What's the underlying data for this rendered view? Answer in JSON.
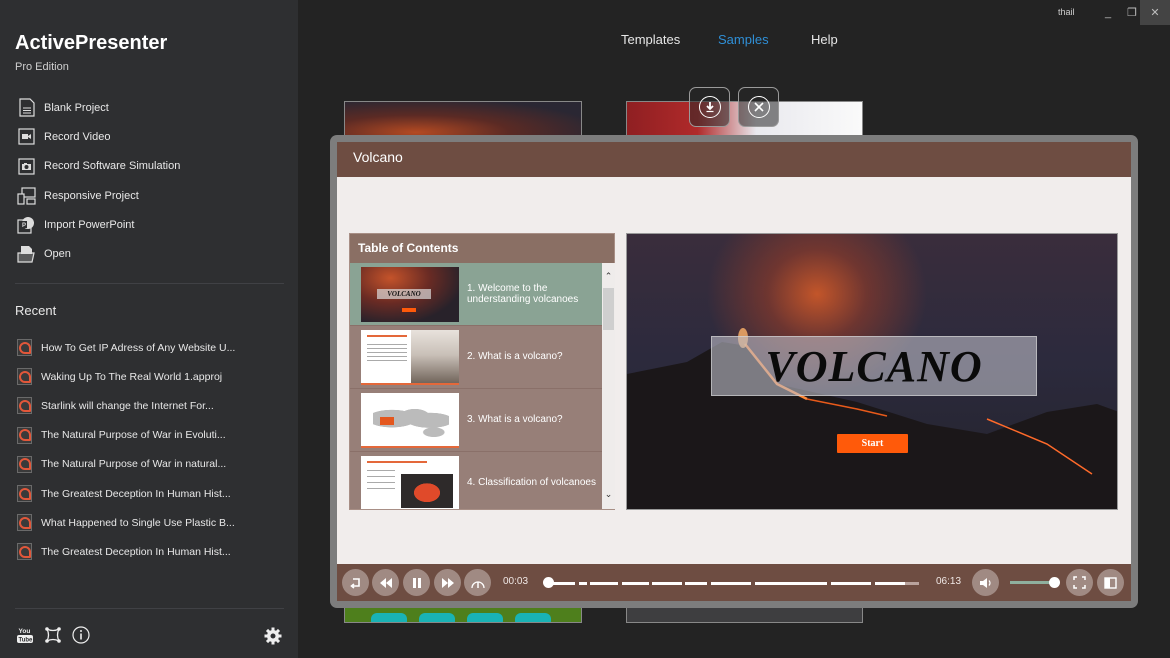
{
  "app": {
    "name": "ActivePresenter",
    "edition": "Pro Edition",
    "user": "thail"
  },
  "window_controls": {
    "minimize": "_",
    "restore": "❐",
    "close": "✕"
  },
  "sidebar": {
    "menu": [
      {
        "label": "Blank Project",
        "icon": "blank-project-icon"
      },
      {
        "label": "Record Video",
        "icon": "record-video-icon"
      },
      {
        "label": "Record Software Simulation",
        "icon": "camera-icon"
      },
      {
        "label": "Responsive Project",
        "icon": "responsive-devices-icon"
      },
      {
        "label": "Import PowerPoint",
        "icon": "powerpoint-icon"
      },
      {
        "label": "Open",
        "icon": "open-folder-icon"
      }
    ],
    "recent_title": "Recent",
    "recent": [
      "How To Get IP Adress of Any Website U...",
      "Waking Up To The Real World 1.approj",
      "Starlink will change the Internet For...",
      "The Natural Purpose of War in Evoluti...",
      "The Natural Purpose of War in natural...",
      "The Greatest Deception  In Human Hist...",
      "What Happened to Single Use Plastic B...",
      "The Greatest Deception  In Human Hist..."
    ],
    "bottom_icons": [
      "youtube-icon",
      "transform-icon",
      "info-icon",
      "gear-icon"
    ]
  },
  "nav": {
    "tabs": [
      {
        "label": "Templates",
        "active": false
      },
      {
        "label": "Samples",
        "active": true
      },
      {
        "label": "Help",
        "active": false
      }
    ],
    "accent_color": "#2f8fd6"
  },
  "preview": {
    "title": "Volcano",
    "toc": {
      "title": "Table of Contents",
      "items": [
        {
          "label": "1. Welcome to the understanding volcanoes",
          "active": true
        },
        {
          "label": "2. What is a volcano?",
          "active": false
        },
        {
          "label": "3. What is a volcano?",
          "active": false
        },
        {
          "label": "4. Classification of volcanoes",
          "active": false
        }
      ]
    },
    "slide": {
      "title": "VOLCANO",
      "start_label": "Start",
      "thumb_title": "VOLCANO"
    },
    "player": {
      "current_time": "00:03",
      "duration": "06:13",
      "progress": 0.008,
      "volume": 0.95
    },
    "colors": {
      "header": "#6e4d42",
      "start_button": "#ff5a0a",
      "active_toc": "#8aa394"
    }
  }
}
